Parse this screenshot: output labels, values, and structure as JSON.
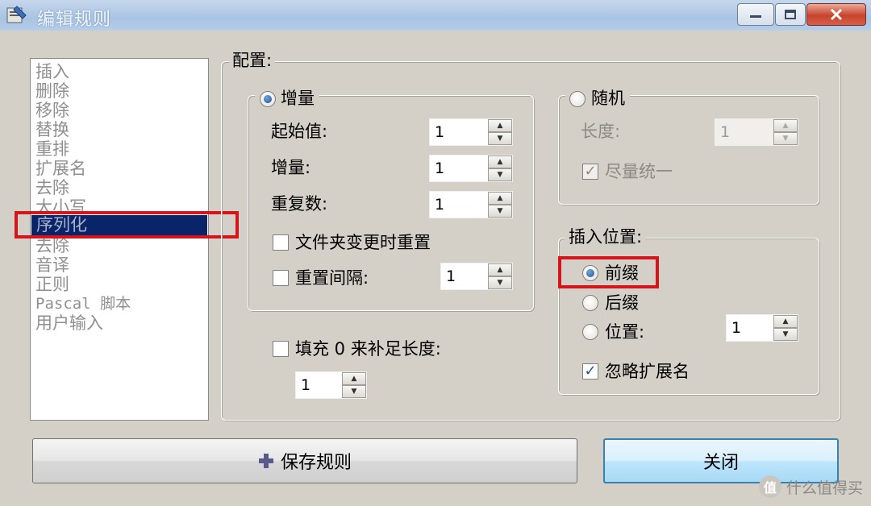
{
  "window": {
    "title": "编辑规则"
  },
  "rule_list": {
    "items": [
      "插入",
      "删除",
      "移除",
      "替换",
      "重排",
      "扩展名",
      "去除",
      "大小写",
      "序列化",
      "去除",
      "音译",
      "正则",
      "Pascal 脚本",
      "用户输入"
    ],
    "selected": "序列化"
  },
  "config": {
    "label": "配置:",
    "increment": {
      "label": "增量",
      "selected": true,
      "start_label": "起始值:",
      "start_value": "1",
      "step_label": "增量:",
      "step_value": "1",
      "repeat_label": "重复数:",
      "repeat_value": "1",
      "reset_folder_label": "文件夹变更时重置",
      "reset_folder_checked": false,
      "reset_interval_label": "重置间隔:",
      "reset_interval_checked": false,
      "reset_interval_value": "1"
    },
    "random": {
      "label": "随机",
      "selected": false,
      "length_label": "长度:",
      "length_value": "1",
      "uniform_label": "尽量统一",
      "uniform_checked": true
    },
    "pad": {
      "label": "填充 0 来补足长度:",
      "checked": false,
      "value": "1"
    },
    "insert_position": {
      "label": "插入位置:",
      "prefix_label": "前缀",
      "prefix_selected": true,
      "suffix_label": "后缀",
      "suffix_selected": false,
      "position_label": "位置:",
      "position_selected": false,
      "position_value": "1",
      "ignore_ext_label": "忽略扩展名",
      "ignore_ext_checked": true
    }
  },
  "buttons": {
    "save": "保存规则",
    "close": "关闭"
  },
  "watermark": {
    "badge": "值",
    "text": "什么值得买"
  },
  "colors": {
    "selection": "#0a246a",
    "highlight_box": "#d5141b",
    "titlebar": "#a9c3e3"
  }
}
